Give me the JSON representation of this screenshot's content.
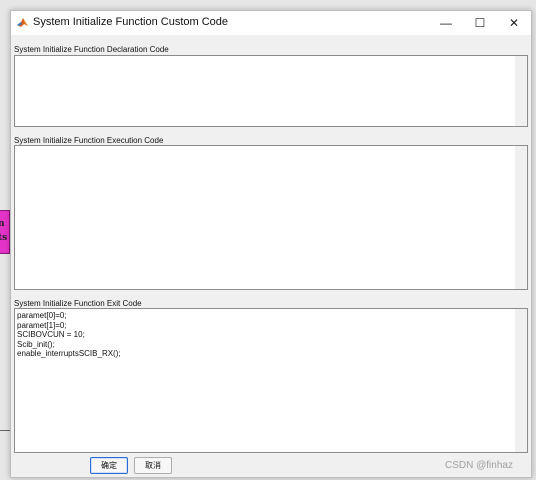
{
  "window": {
    "title": "System Initialize Function Custom Code",
    "minimize_glyph": "—",
    "maximize_glyph": "☐",
    "close_glyph": "✕"
  },
  "background": {
    "block_text_top": "n",
    "block_text_bottom": "ts"
  },
  "sections": {
    "declaration": {
      "label": "System Initialize Function Declaration Code",
      "lines": []
    },
    "execution": {
      "label": "System Initialize Function Execution Code",
      "lines": []
    },
    "exit": {
      "label": "System Initialize Function Exit Code",
      "lines": [
        "paramet[0]=0;",
        "paramet[1]=0;",
        "SCIBOVCUN = 10;",
        "Scib_init();",
        "enable_interruptsSCIB_RX();"
      ]
    }
  },
  "buttons": {
    "ok_label": "确定",
    "cancel_label": "取消"
  },
  "watermark": "CSDN @finhaz",
  "icons": {
    "app": "matlab-icon"
  }
}
